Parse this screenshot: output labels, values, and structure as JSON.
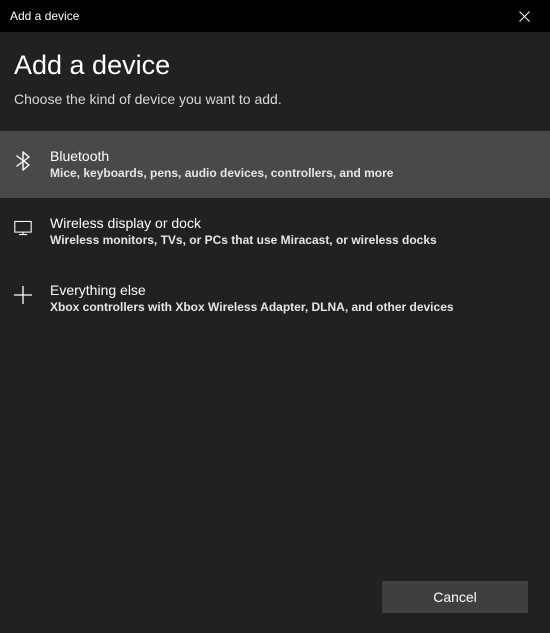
{
  "titlebar": {
    "title": "Add a device"
  },
  "content": {
    "heading": "Add a device",
    "subheading": "Choose the kind of device you want to add."
  },
  "options": [
    {
      "title": "Bluetooth",
      "desc": "Mice, keyboards, pens, audio devices, controllers, and more"
    },
    {
      "title": "Wireless display or dock",
      "desc": "Wireless monitors, TVs, or PCs that use Miracast, or wireless docks"
    },
    {
      "title": "Everything else",
      "desc": "Xbox controllers with Xbox Wireless Adapter, DLNA, and other devices"
    }
  ],
  "footer": {
    "cancel": "Cancel"
  }
}
